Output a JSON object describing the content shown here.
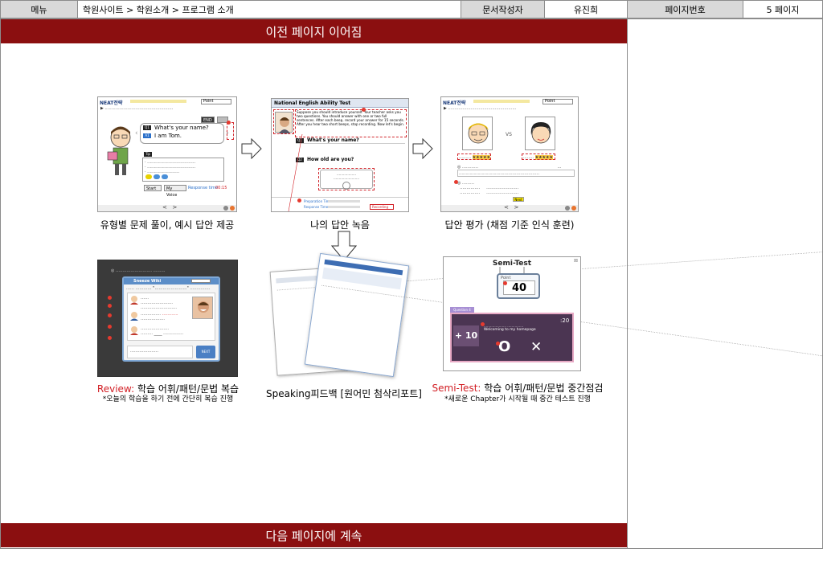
{
  "header": {
    "menu_label": "메뉴",
    "breadcrumb": "학원사이트 > 학원소개 > 프로그램 소개",
    "author_label": "문서작성자",
    "author_name": "유진희",
    "page_no_label": "페이지번호",
    "page_no_value": "5 페이지"
  },
  "banner_top": "이전 페이지 이어짐",
  "banner_bottom": "다음 페이지에 계속",
  "panels": {
    "p1": {
      "caption": "유형별 문제 풀이, 예시 답안 제공",
      "brand": "NEAT전략",
      "mode": "Point",
      "end_btn": "END",
      "q1": "What's your name?",
      "a1": "I am Tom.",
      "q1_tag": "Q1",
      "a1_tag": "A1",
      "tip_tag": "Tip",
      "btn_start": "Start",
      "btn_myvoice": "My Voice",
      "response_label": "Response time",
      "response_value": "00:15"
    },
    "p2": {
      "caption": "나의 답안 녹음",
      "title": "National English Ability Test",
      "instruction": "Suppose you should introduce yourself. Your teacher asks you two questions. You should answer with one or two full sentences. After each beep, record your answer for 15 seconds. After you hear two short beeps, stop recording. Now let's begin.",
      "q1": "What's your name?",
      "q2": "How old are you?",
      "q1_tag": "Q1",
      "q2_tag": "Q2",
      "prep_label": "Preparation Time",
      "resp_label": "Response Time",
      "recording": "Recording"
    },
    "p3": {
      "caption": "답안 평가 (채점 기준 인식 훈련)",
      "brand": "NEAT전략",
      "mode": "Point",
      "vs": "VS",
      "next_btn": "Next"
    },
    "p4": {
      "caption_red": "Review:",
      "caption_rest": " 학습 어휘/패턴/문법 복습",
      "sub": "*오늘의 학습을 하기 전에 간단히 복습 진행",
      "tab": "Sneeze Wiki",
      "btn": "NEXT"
    },
    "p5": {
      "caption": "Speaking피드백 [원어민 첨삭리포트]"
    },
    "p6": {
      "caption_red": "Semi-Test:",
      "caption_rest": " 학습 어휘/패턴/문법 중간점검",
      "sub": "*새로운 Chapter가 시작될 때 중간 테스트 진행",
      "title": "Semi-Test",
      "point_label": "Point",
      "point_value": "40",
      "question_tab": "Question 4",
      "plus": "+ 10",
      "timer": ":20",
      "q_text": "Welcoming to my homepage",
      "o_mark": "O",
      "x_mark": "✕"
    }
  }
}
